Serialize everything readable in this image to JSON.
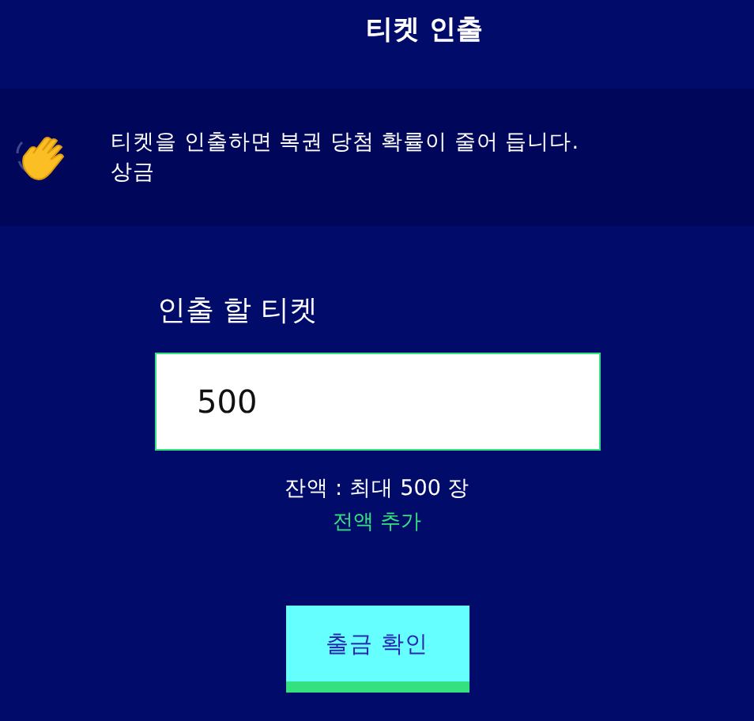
{
  "header": {
    "title": "티켓 인출"
  },
  "notice": {
    "lines": [
      "티켓을 인출하면 복권 당첨 확률이 줄어 듭니다.",
      "상금"
    ]
  },
  "form": {
    "label": "인출 할 티켓",
    "value": "500",
    "balance": "잔액 : 최대 500 장",
    "link": "전액 추가"
  },
  "button": {
    "label": "출금 확인"
  }
}
